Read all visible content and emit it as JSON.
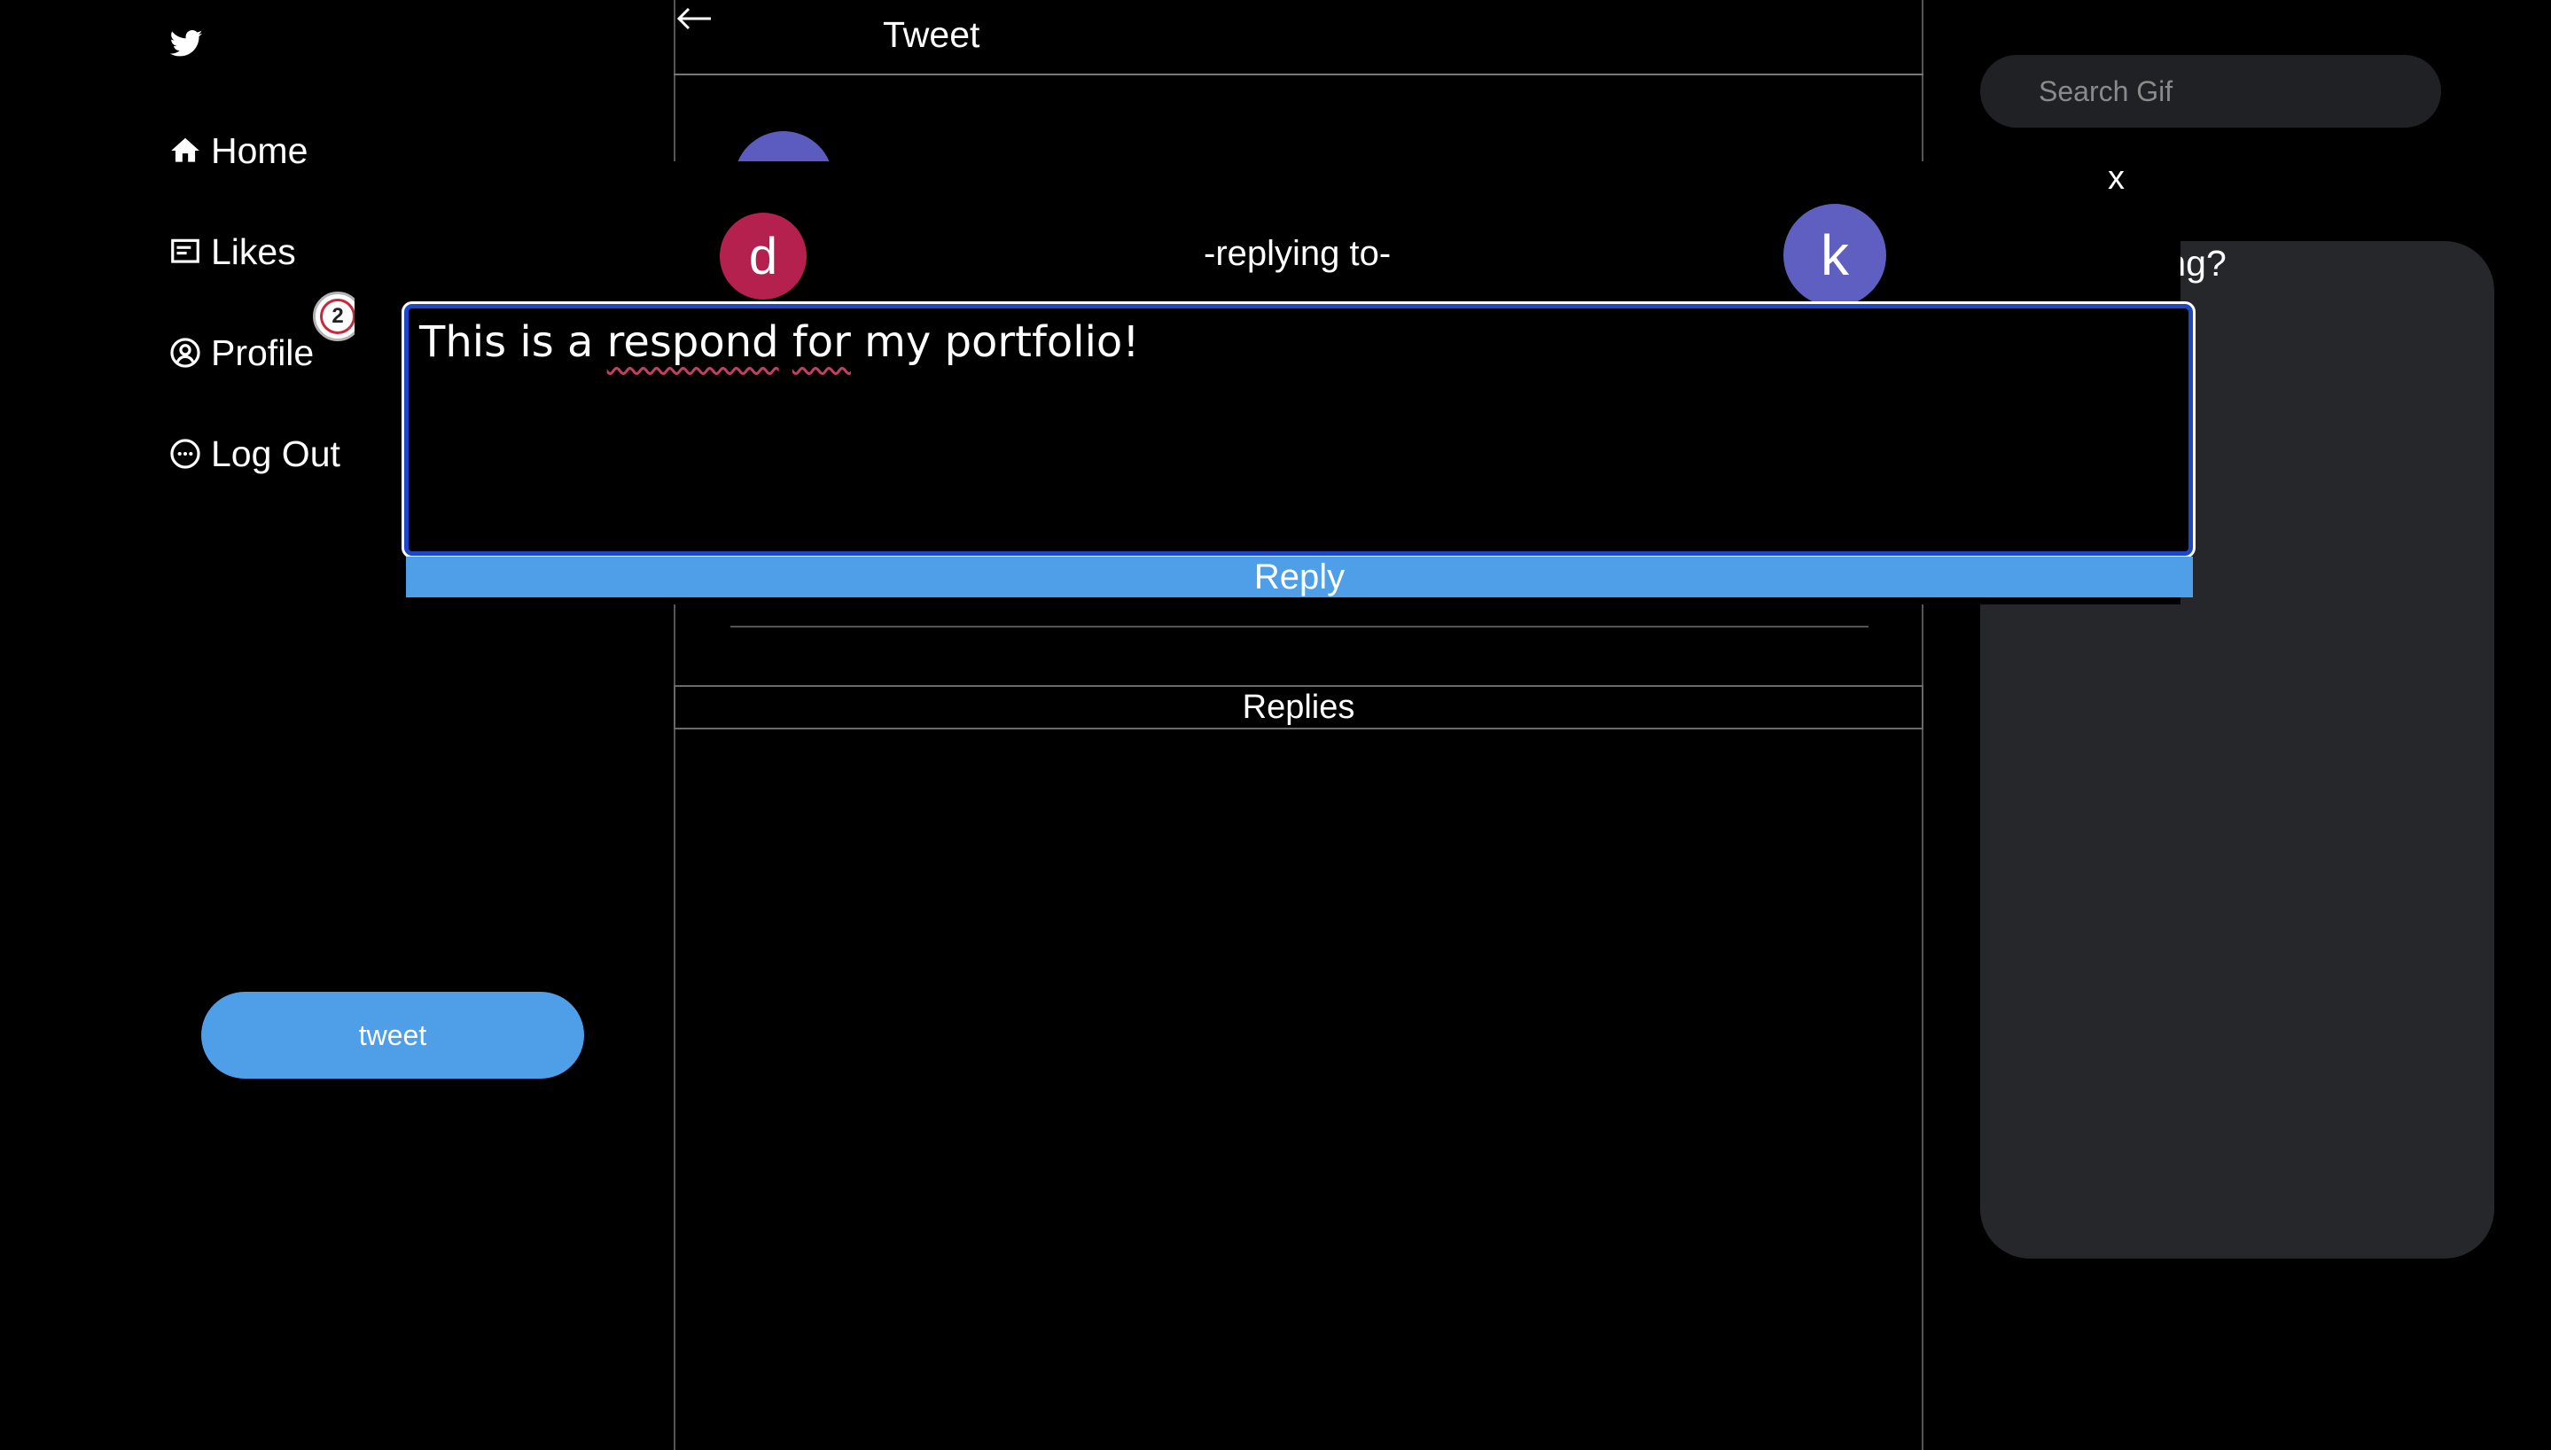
{
  "sidebar": {
    "logo_icon": "twitter-bird-icon",
    "items": [
      {
        "label": "Home",
        "icon": "home-icon"
      },
      {
        "label": "Likes",
        "icon": "likes-list-icon"
      },
      {
        "label": "Profile",
        "icon": "profile-icon"
      },
      {
        "label": "Log Out",
        "icon": "logout-icon"
      }
    ],
    "badge_count": "2",
    "tweet_button": "tweet"
  },
  "main": {
    "header_title": "Tweet",
    "replies_label": "Replies"
  },
  "right": {
    "search_placeholder": "Search Gif",
    "panel_prompt": "What's happening?"
  },
  "modal": {
    "close_label": "x",
    "from_avatar": "d",
    "to_avatar": "k",
    "replying_label": "-replying to-",
    "reply_text": "This is a respond for my portfolio!",
    "reply_button": "Reply"
  },
  "colors": {
    "accent": "#4e9fe8",
    "avatar_d": "#b5214f",
    "avatar_k": "#5e5fc0",
    "panel": "#26272a",
    "focus_border": "#1c47c9"
  }
}
